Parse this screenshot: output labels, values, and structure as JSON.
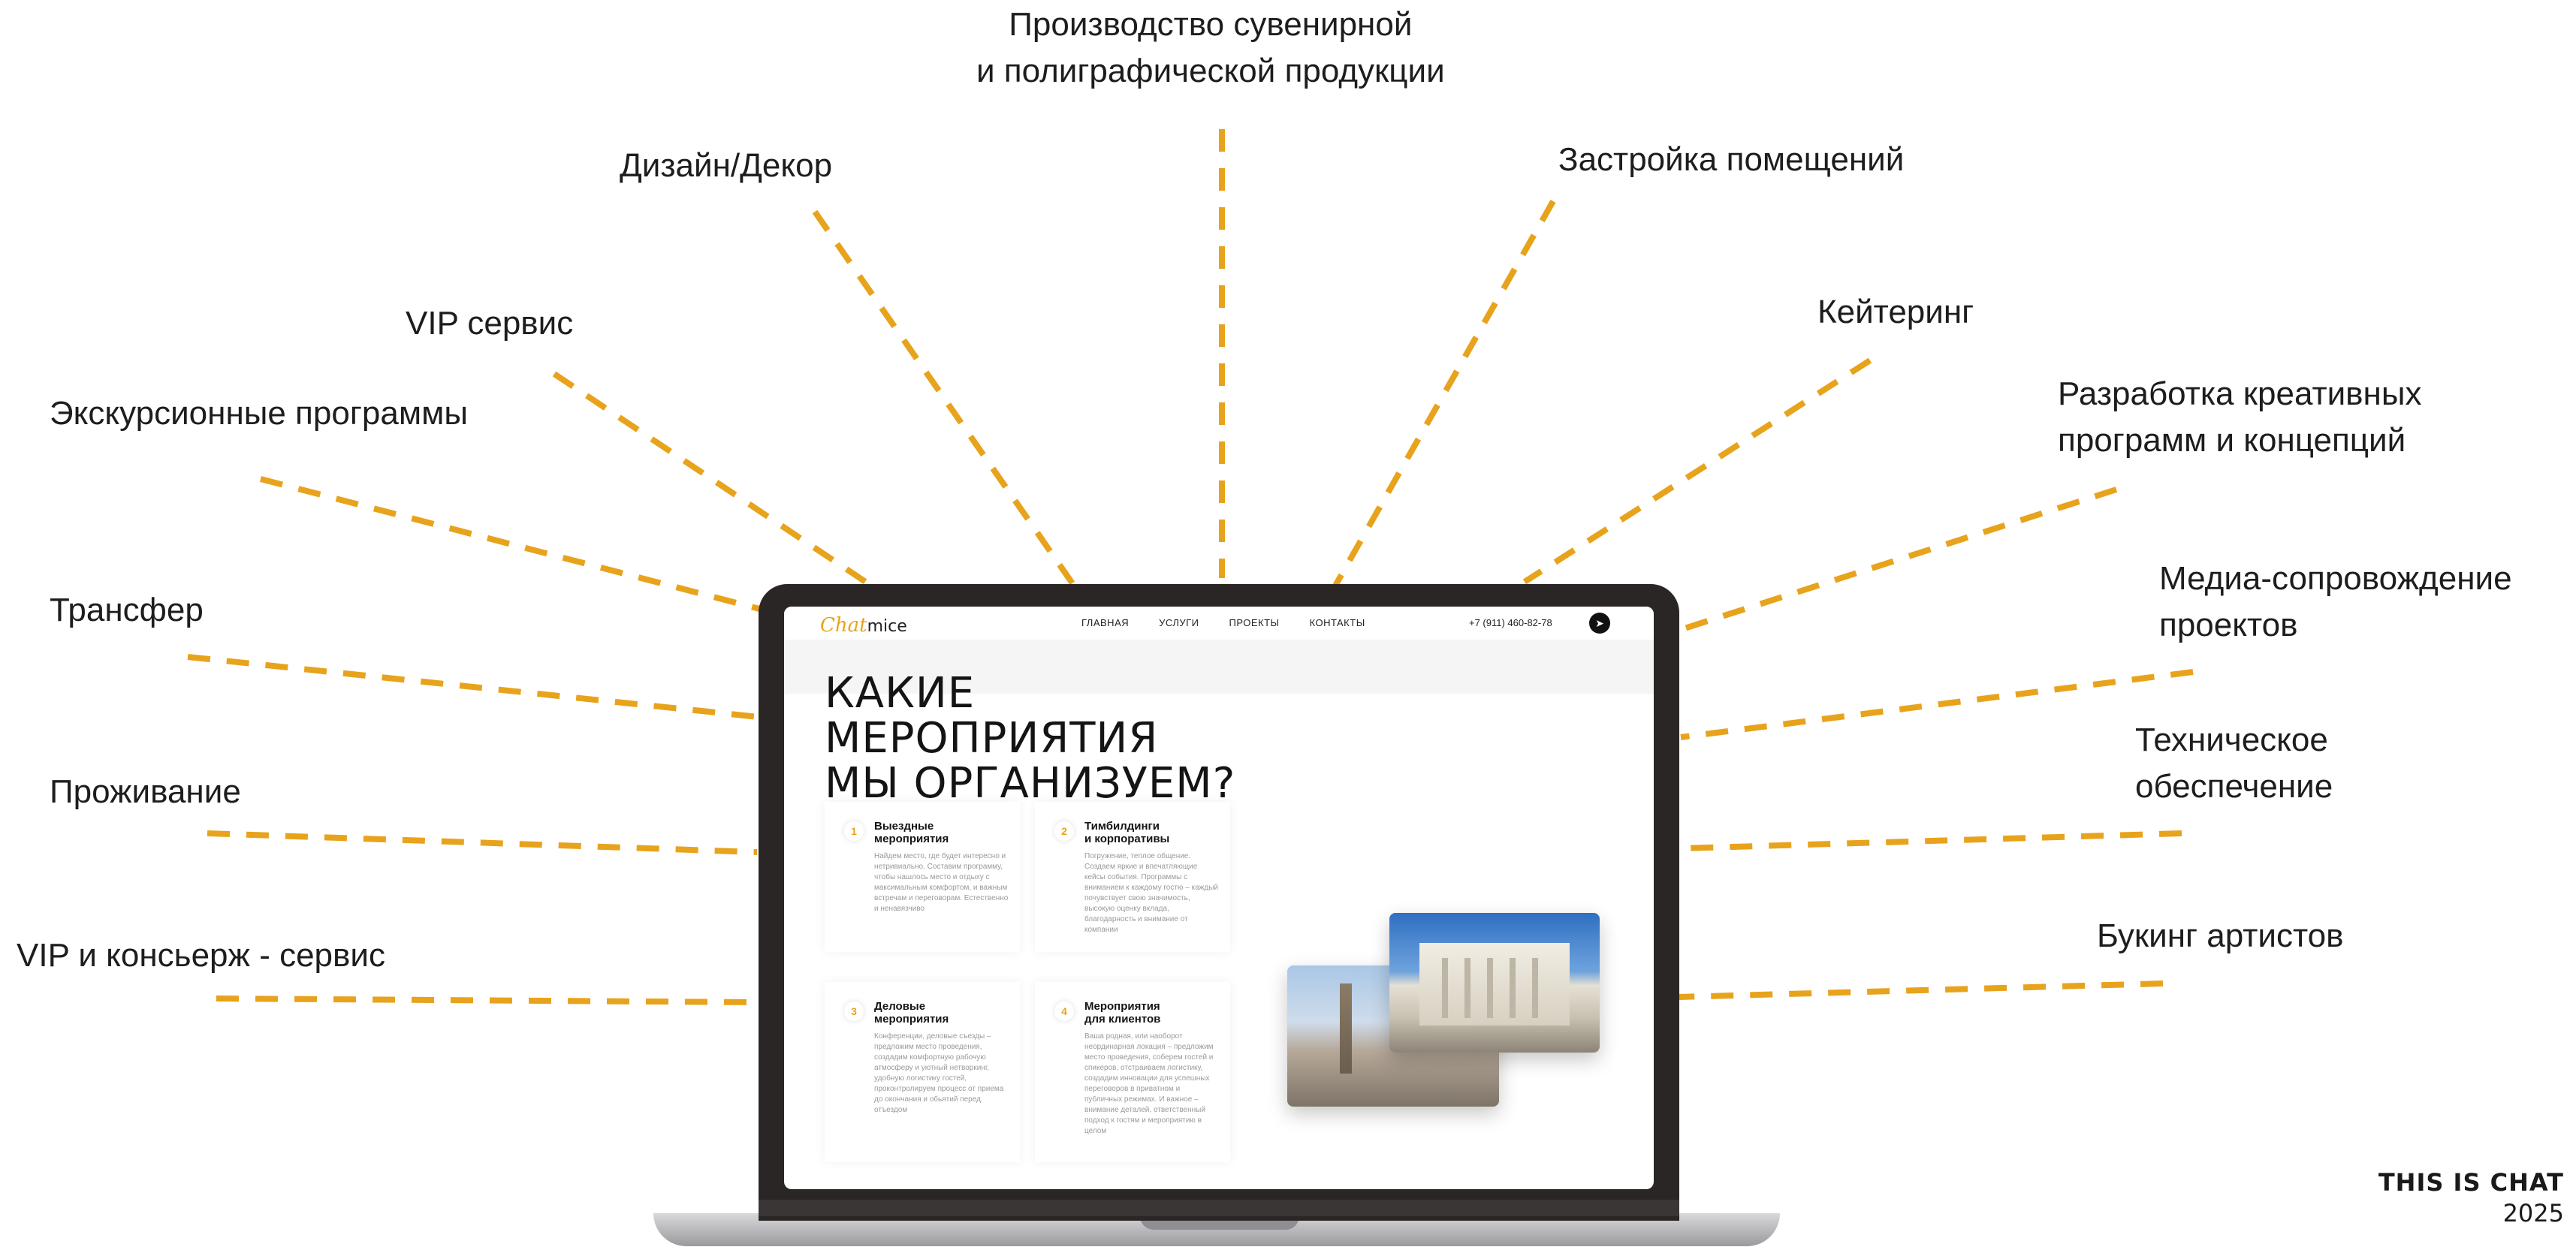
{
  "colors": {
    "accent": "#e8a31c",
    "text": "#1d1d1d",
    "laptop_bezel": "#2a2626"
  },
  "rays_labels": {
    "top_center_1": "Производство сувенирной",
    "top_center_2": "и полиграфической продукции",
    "design": "Дизайн/Декор",
    "build": "Застройка помещений",
    "vip": "VIP сервис",
    "catering": "Кейтеринг",
    "excursions": "Экскурсионные программы",
    "creative_1": "Разработка креативных",
    "creative_2": "программ и концепций",
    "transfer": "Трансфер",
    "media_1": "Медиа-сопровождение",
    "media_2": "проектов",
    "lodging": "Проживание",
    "tech_1": "Техническое",
    "tech_2": "обеспечение",
    "concierge": "VIP и консьерж - сервис",
    "booking": "Букинг артистов"
  },
  "brand": {
    "line1": "THIS IS CHAT",
    "line2": "2025"
  },
  "site": {
    "logo_a": "Chat",
    "logo_b": "mice",
    "menu": [
      "ГЛАВНАЯ",
      "УСЛУГИ",
      "ПРОЕКТЫ",
      "КОНТАКТЫ"
    ],
    "phone": "+7 (911) 460-82-78",
    "telegram_icon": "➤",
    "title": [
      "КАКИЕ",
      "МЕРОПРИЯТИЯ",
      "МЫ ОРГАНИЗУЕМ?"
    ],
    "cards": [
      {
        "num": "1",
        "h1": "Выездные",
        "h2": "мероприятия",
        "body": "Найдем место, где будет интересно и нетривиально. Составим программу, чтобы нашлось место и отдыху с максимальным комфортом, и важным встречам и переговорам. Естественно и ненавязчиво"
      },
      {
        "num": "2",
        "h1": "Тимбилдинги",
        "h2": "и корпоративы",
        "body": "Погружение, теплое общение. Создаем яркие и впечатляющие кейсы события. Программы с вниманием к каждому гостю – каждый почувствует свою значимость, высокую оценку вклада, благодарность и внимание от компании"
      },
      {
        "num": "3",
        "h1": "Деловые",
        "h2": "мероприятия",
        "body": "Конференции, деловые съезды – предложим место проведения, создадим комфортную рабочую атмосферу и уютный нетворкинг, удобную логистику гостей, проконтролируем процесс от приема до окончания и обьятий перед отъездом"
      },
      {
        "num": "4",
        "h1": "Мероприятия",
        "h2": "для клиентов",
        "body": "Ваша родная, или наоборот неординарная локация – предложим место проведения, соберем гостей и спикеров, отстраиваем логистику, создадим инновации для успешных переговоров в приватном и публичных режимах. И важное – внимание деталей, ответственный подход к гостям и мероприятию в целом"
      }
    ]
  }
}
